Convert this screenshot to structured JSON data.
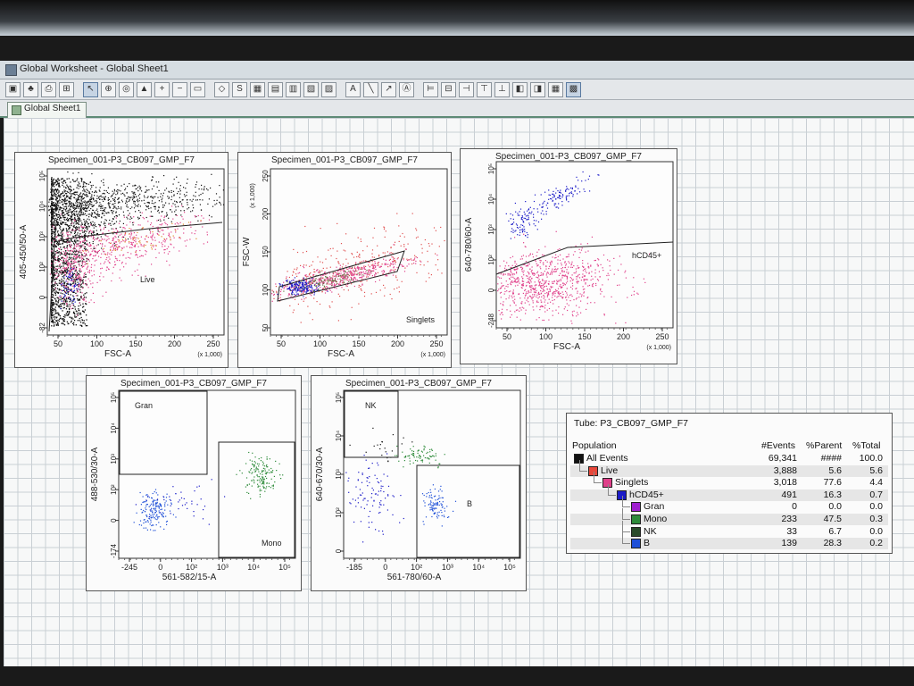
{
  "window": {
    "title": "Global Worksheet - Global Sheet1"
  },
  "tabs": [
    {
      "label": "Global Sheet1"
    }
  ],
  "toolbar_icons": [
    "save-icon",
    "print-icon",
    "export-icon",
    "import-icon",
    "pointer-icon",
    "zoom-icon",
    "gate-icon",
    "histogram-icon",
    "zoom-in-icon",
    "zoom-out-icon",
    "layout-icon",
    "polygon-gate-icon",
    "snap-gate-icon",
    "grid-layout-icon",
    "grid-icon",
    "dot-plot-icon",
    "contour-icon",
    "density-icon",
    "text-icon",
    "line-icon",
    "arrow-icon",
    "label-icon",
    "align-left-icon",
    "align-center-icon",
    "align-right-icon",
    "align-top-icon",
    "distribute-icon",
    "bring-front-icon",
    "send-back-icon",
    "show-grid-icon",
    "table-icon"
  ],
  "plots": [
    {
      "title": "Specimen_001-P3_CB097_GMP_F7",
      "xlabel": "FSC-A",
      "ylabel": "405-450/50-A",
      "xticks": [
        "50",
        "100",
        "150",
        "200",
        "250"
      ],
      "xmult": "(x 1,000)",
      "yticks": [
        "-82",
        "0",
        "10²",
        "10³",
        "10⁴",
        "10⁵"
      ],
      "gates": [
        {
          "name": "Live"
        }
      ]
    },
    {
      "title": "Specimen_001-P3_CB097_GMP_F7",
      "xlabel": "FSC-A",
      "ylabel": "FSC-W",
      "xticks": [
        "50",
        "100",
        "150",
        "200",
        "250"
      ],
      "xmult": "(x 1,000)",
      "yticks": [
        "50",
        "100",
        "150",
        "200",
        "250"
      ],
      "ymult": "(x 1,000)",
      "gates": [
        {
          "name": "Singlets"
        }
      ]
    },
    {
      "title": "Specimen_001-P3_CB097_GMP_F7",
      "xlabel": "FSC-A",
      "ylabel": "640-780/60-A",
      "xticks": [
        "50",
        "100",
        "150",
        "200",
        "250"
      ],
      "xmult": "(x 1,000)",
      "yticks": [
        "-248",
        "0",
        "10²",
        "10³",
        "10⁴",
        "10⁵"
      ],
      "gates": [
        {
          "name": "hCD45+"
        }
      ]
    },
    {
      "title": "Specimen_001-P3_CB097_GMP_F7",
      "xlabel": "561-582/15-A",
      "ylabel": "488-530/30-A",
      "xticks": [
        "-245",
        "0",
        "10²",
        "10³",
        "10⁴",
        "10⁵"
      ],
      "yticks": [
        "-174",
        "0",
        "10²",
        "10³",
        "10⁴",
        "10⁵"
      ],
      "gates": [
        {
          "name": "Gran"
        },
        {
          "name": "Mono"
        }
      ]
    },
    {
      "title": "Specimen_001-P3_CB097_GMP_F7",
      "xlabel": "561-780/60-A",
      "ylabel": "640-670/30-A",
      "xticks": [
        "-185",
        "0",
        "10²",
        "10³",
        "10⁴",
        "10⁵"
      ],
      "yticks": [
        "0",
        "10²",
        "10³",
        "10⁴",
        "10⁵"
      ],
      "gates": [
        {
          "name": "NK"
        },
        {
          "name": "B"
        }
      ]
    }
  ],
  "stats": {
    "tube": "Tube:  P3_CB097_GMP_F7",
    "headers": {
      "population": "Population",
      "events": "#Events",
      "parent": "%Parent",
      "total": "%Total"
    },
    "rows": [
      {
        "name": "All Events",
        "events": "69,341",
        "parent": "####",
        "total": "100.0",
        "color": "#111111",
        "level": 0
      },
      {
        "name": "Live",
        "events": "3,888",
        "parent": "5.6",
        "total": "5.6",
        "color": "#e8473a",
        "level": 1
      },
      {
        "name": "Singlets",
        "events": "3,018",
        "parent": "77.6",
        "total": "4.4",
        "color": "#e0408a",
        "level": 2
      },
      {
        "name": "hCD45+",
        "events": "491",
        "parent": "16.3",
        "total": "0.7",
        "color": "#1b1bc8",
        "level": 3
      },
      {
        "name": "Gran",
        "events": "0",
        "parent": "0.0",
        "total": "0.0",
        "color": "#a020d0",
        "level": 4
      },
      {
        "name": "Mono",
        "events": "233",
        "parent": "47.5",
        "total": "0.3",
        "color": "#2e8b3a",
        "level": 4
      },
      {
        "name": "NK",
        "events": "33",
        "parent": "6.7",
        "total": "0.0",
        "color": "#2a4a2a",
        "level": 4
      },
      {
        "name": "B",
        "events": "139",
        "parent": "28.3",
        "total": "0.2",
        "color": "#1f50d8",
        "level": 4
      }
    ]
  },
  "population_colors": {
    "all": "#111111",
    "live": "#e0408a",
    "hcd45": "#1b1bc8",
    "mono": "#2e8b3a",
    "b": "#1f50d8",
    "orange": "#e08a2a"
  }
}
